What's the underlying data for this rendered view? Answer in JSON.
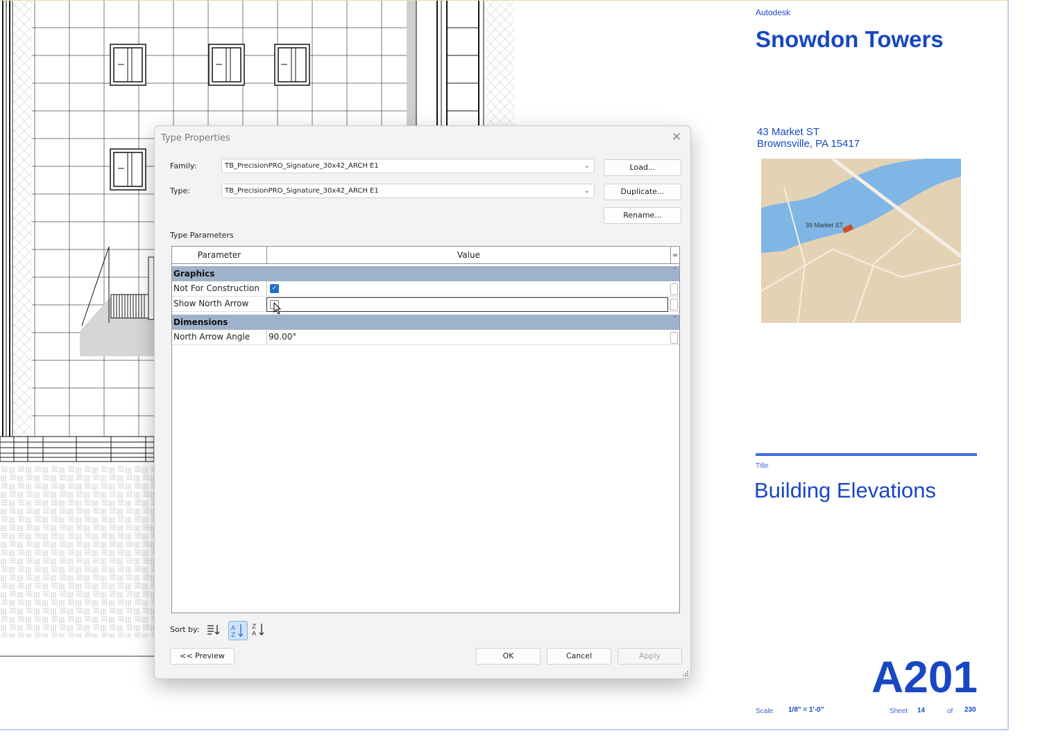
{
  "title_block": {
    "company": "Autodesk",
    "project_name": "Snowdon Towers",
    "address_line1": "43 Market ST",
    "address_line2": "Brownsville, PA 15417",
    "map_label": "39 Market ST",
    "title_label": "Title",
    "sheet_title": "Building Elevations",
    "sheet_number": "A201",
    "scale_label": "Scale",
    "scale_value": "1/8\" = 1'-0\"",
    "sheet_label": "Sheet",
    "sheet_index": "14",
    "of_label": "of",
    "sheet_total": "230",
    "brand_color": "#1747c2"
  },
  "dialog": {
    "title": "Type Properties",
    "family_label": "Family:",
    "family_value": "TB_PrecisionPRO_Signature_30x42_ARCH E1",
    "type_label": "Type:",
    "type_value": "TB_PrecisionPRO_Signature_30x42_ARCH E1",
    "load_label": "Load...",
    "duplicate_label": "Duplicate...",
    "rename_label": "Rename...",
    "type_params_label": "Type Parameters",
    "grid": {
      "col_parameter": "Parameter",
      "col_value": "Value",
      "group_graphics": "Graphics",
      "group_dimensions": "Dimensions",
      "rows": [
        {
          "name": "Not For Construction",
          "checked": true
        },
        {
          "name": "Show North Arrow",
          "checked": false
        },
        {
          "name": "North Arrow Angle",
          "value": "90.00°"
        }
      ]
    },
    "sort_label": "Sort by:",
    "preview_label": "<< Preview",
    "ok_label": "OK",
    "cancel_label": "Cancel",
    "apply_label": "Apply"
  }
}
